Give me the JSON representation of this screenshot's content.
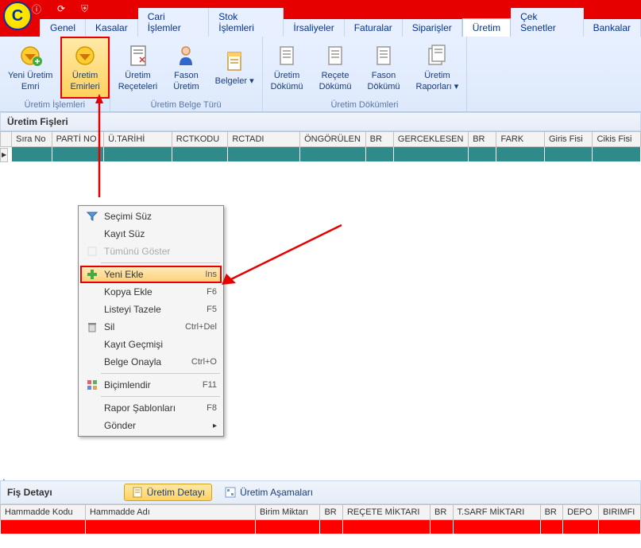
{
  "tabs": [
    "Genel",
    "Kasalar",
    "Cari İşlemler",
    "Stok İşlemleri",
    "İrsaliyeler",
    "Faturalar",
    "Siparişler",
    "Üretim",
    "Çek Senetler",
    "Bankalar"
  ],
  "activeTab": "Üretim",
  "ribbon": {
    "group1": {
      "title": "Üretim İşlemleri",
      "items": [
        {
          "label": "Yeni Üretim\nEmri",
          "highlighted": false
        },
        {
          "label": "Üretim\nEmirleri",
          "highlighted": true
        }
      ]
    },
    "group2": {
      "title": "Üretim Belge Türü",
      "items": [
        {
          "label": "Üretim\nReçeteleri"
        },
        {
          "label": "Fason\nÜretim"
        },
        {
          "label": "Belgeler ▾"
        }
      ]
    },
    "group3": {
      "title": "Üretim Dökümleri",
      "items": [
        {
          "label": "Üretim\nDökümü"
        },
        {
          "label": "Reçete\nDökümü"
        },
        {
          "label": "Fason\nDökümü"
        },
        {
          "label": "Üretim\nRaporları ▾"
        }
      ]
    }
  },
  "sectionMain": "Üretim Fişleri",
  "mainCols": [
    "Sıra No",
    "PARTİ NO",
    "Ü.TARİHİ",
    "RCTKODU",
    "RCTADI",
    "ÖNGÖRÜLEN",
    "BR",
    "GERCEKLESEN",
    "BR",
    "FARK",
    "Giris Fisi",
    "Cikis Fisi"
  ],
  "contextMenu": {
    "items": [
      {
        "label": "Seçimi Süz",
        "icon": "funnel-icon"
      },
      {
        "label": "Kayıt Süz"
      },
      {
        "label": "Tümünü Göster",
        "disabled": true,
        "icon": "blank-icon"
      },
      {
        "sep": true
      },
      {
        "label": "Yeni Ekle",
        "shortcut": "Ins",
        "highlighted": true,
        "icon": "plus-icon"
      },
      {
        "label": "Kopya Ekle",
        "shortcut": "F6"
      },
      {
        "label": "Listeyi Tazele",
        "shortcut": "F5"
      },
      {
        "label": "Sil",
        "shortcut": "Ctrl+Del",
        "icon": "trash-icon"
      },
      {
        "label": "Kayıt Geçmişi"
      },
      {
        "label": "Belge Onayla",
        "shortcut": "Ctrl+O"
      },
      {
        "sep": true
      },
      {
        "label": "Biçimlendir",
        "shortcut": "F11",
        "icon": "format-icon"
      },
      {
        "sep": true
      },
      {
        "label": "Rapor Şablonları",
        "shortcut": "F8"
      },
      {
        "label": "Gönder",
        "submenu": true
      }
    ]
  },
  "sectionDetail": "Fiş Detayı",
  "detailBtn1": "Üretim Detayı",
  "detailBtn2": "Üretim Aşamaları",
  "detailCols": [
    "Hammadde Kodu",
    "Hammadde Adı",
    "Birim Miktarı",
    "BR",
    "REÇETE MİKTARI",
    "BR",
    "T.SARF MİKTARI",
    "BR",
    "DEPO",
    "BIRIMFI"
  ]
}
